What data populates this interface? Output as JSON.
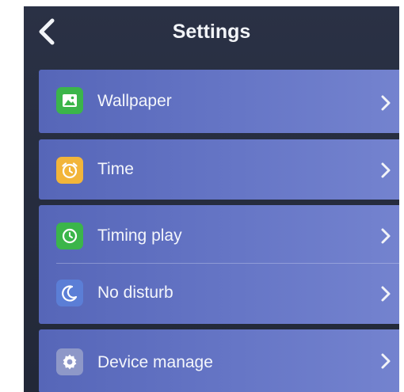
{
  "header": {
    "title": "Settings",
    "back_icon": "chevron-left-icon"
  },
  "items": [
    {
      "label": "Wallpaper",
      "icon": "image-icon",
      "icon_color": "#3bb54a"
    },
    {
      "label": "Time",
      "icon": "alarm-clock-icon",
      "icon_color": "#f2b53a"
    },
    {
      "label": "Timing play",
      "icon": "clock-icon",
      "icon_color": "#3bb54a"
    },
    {
      "label": "No disturb",
      "icon": "moon-icon",
      "icon_color": "#5b7ed6"
    },
    {
      "label": "Device manage",
      "icon": "gear-icon",
      "icon_color": "#8e98c8"
    }
  ],
  "colors": {
    "panel": "#6172c0",
    "background": "#252b3b",
    "text": "#f4f6fb"
  }
}
